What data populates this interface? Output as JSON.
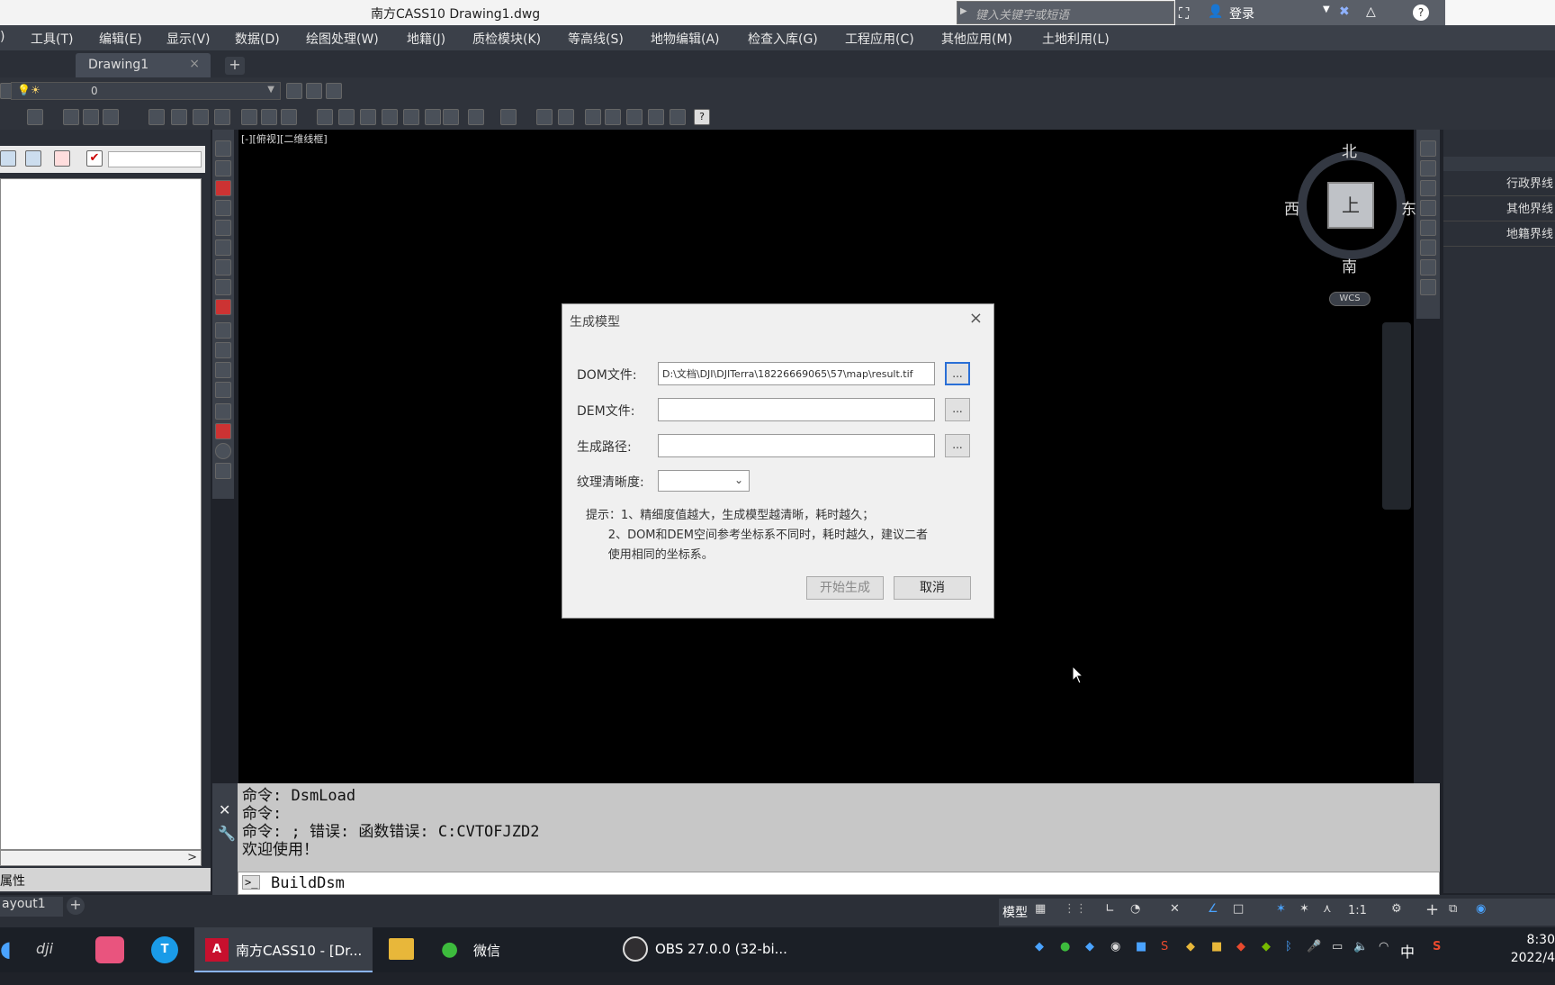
{
  "window": {
    "title": "南方CASS10    Drawing1.dwg",
    "search_placeholder": "键入关键字或短语",
    "login_label": "登录"
  },
  "menu": [
    "工具(T)",
    "编辑(E)",
    "显示(V)",
    "数据(D)",
    "绘图处理(W)",
    "地籍(J)",
    "质检模块(K)",
    "等高线(S)",
    "地物编辑(A)",
    "检查入库(G)",
    "工程应用(C)",
    "其他应用(M)",
    "土地利用(L)"
  ],
  "menu_partial": ")",
  "doc_tab": {
    "label": "Drawing1",
    "close": "×",
    "new": "+"
  },
  "layer": {
    "current": "0"
  },
  "left_panel": {
    "scroll_arrow": ">",
    "tab_label": "属性"
  },
  "viewport_label": "[-][俯视][二维线框]",
  "viewcube": {
    "north": "北",
    "south": "南",
    "east": "东",
    "west": "西",
    "top": "上",
    "wcs": "WCS"
  },
  "right_panel": {
    "items": [
      "行政界线",
      "其他界线",
      "地籍界线"
    ]
  },
  "dialog": {
    "title": "生成模型",
    "close": "×",
    "dom_label": "DOM文件:",
    "dom_value": "D:\\文档\\DJI\\DJITerra\\18226669065\\57\\map\\result.tif",
    "dem_label": "DEM文件:",
    "dem_value": "",
    "out_label": "生成路径:",
    "out_value": "",
    "browse": "...",
    "tex_label": "纹理清晰度:",
    "tip_line1": "提示：1、精细度值越大，生成模型越清晰，耗时越久；",
    "tip_line2": "      2、DOM和DEM空间参考坐标系不同时，耗时越久，建议二者",
    "tip_line3": "      使用相同的坐标系。",
    "start_btn": "开始生成",
    "cancel_btn": "取消"
  },
  "command": {
    "history": [
      "命令: DsmLoad",
      "命令:",
      "命令: ; 错误: 函数错误: C:CVTOFJZD2",
      "欢迎使用！"
    ],
    "input": "BuildDsm",
    "prompt": ">_"
  },
  "layout": {
    "tab": "ayout1",
    "plus": "+"
  },
  "statusbar": {
    "model": "模型",
    "scale": "1:1"
  },
  "taskbar": {
    "cass": "南方CASS10 - [Dr...",
    "wechat": "微信",
    "obs": "OBS 27.0.0 (32-bi...",
    "ime": "中",
    "time": "8:30",
    "date": "2022/4"
  }
}
